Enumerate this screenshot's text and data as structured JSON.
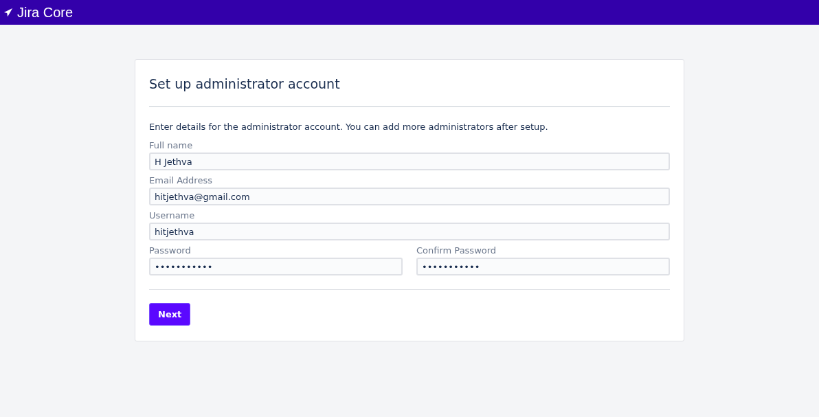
{
  "header": {
    "product": "Jira Core"
  },
  "card": {
    "title": "Set up administrator account",
    "intro": "Enter details for the administrator account. You can add more administrators after setup.",
    "rows": [
      [
        {
          "label": "Full name",
          "value": "H Jethva"
        }
      ],
      [
        {
          "label": "Email Address",
          "value": "hitjethva@gmail.com"
        }
      ],
      [
        {
          "label": "Username",
          "value": "hitjethva"
        }
      ],
      [
        {
          "label": "Password",
          "value": "•••••••••••"
        },
        {
          "label": "Confirm Password",
          "value": "•••••••••••"
        }
      ]
    ],
    "button": "Next"
  }
}
